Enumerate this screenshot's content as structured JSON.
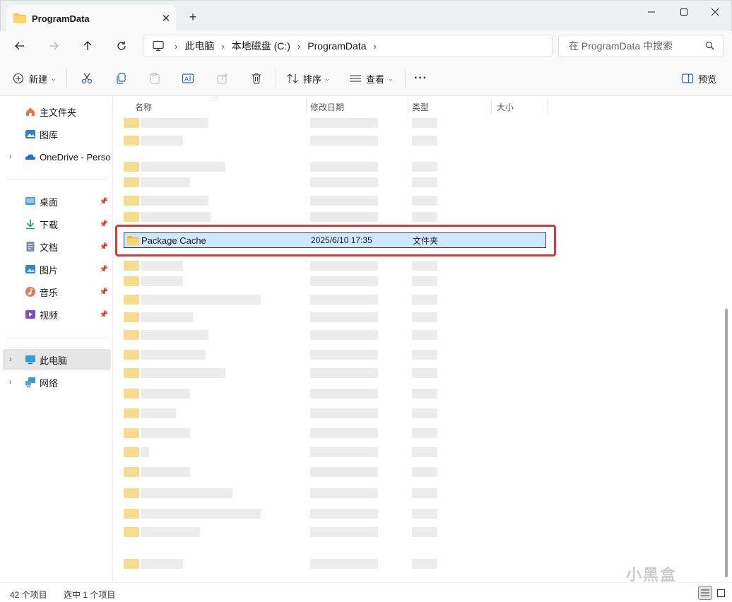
{
  "window": {
    "tab_title": "ProgramData",
    "new_tab": "+"
  },
  "address": {
    "crumbs": [
      "此电脑",
      "本地磁盘 (C:)",
      "ProgramData"
    ],
    "search_placeholder": "在 ProgramData 中搜索"
  },
  "toolbar": {
    "new_label": "新建",
    "sort_label": "排序",
    "view_label": "查看",
    "more_label": "···",
    "preview_label": "预览"
  },
  "sidebar": {
    "items": [
      {
        "label": "主文件夹"
      },
      {
        "label": "图库"
      },
      {
        "label": "OneDrive - Perso"
      },
      {
        "label": "桌面"
      },
      {
        "label": "下载"
      },
      {
        "label": "文档"
      },
      {
        "label": "图片"
      },
      {
        "label": "音乐"
      },
      {
        "label": "视频"
      },
      {
        "label": "此电脑"
      },
      {
        "label": "网络"
      }
    ]
  },
  "columns": {
    "name": "名称",
    "date": "修改日期",
    "type": "类型",
    "size": "大小"
  },
  "selected_file": {
    "name": "Package Cache",
    "date": "2025/6/10 17:35",
    "type": "文件夹"
  },
  "status": {
    "count": "42 个项目",
    "selected": "选中 1 个项目"
  },
  "watermark": "小黑盒",
  "colors": {
    "accent": "#0067c0",
    "selection_bg": "#cde8ff",
    "highlight_box": "#d73a3a",
    "folder": "#f7c948"
  }
}
